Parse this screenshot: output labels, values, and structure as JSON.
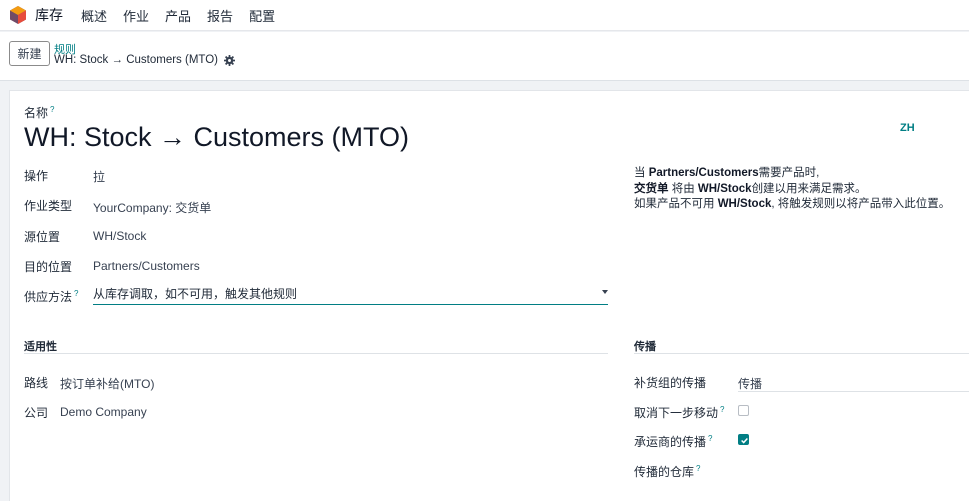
{
  "topnav": {
    "app_name": "库存",
    "menu": [
      "概述",
      "作业",
      "产品",
      "报告",
      "配置"
    ]
  },
  "controlbar": {
    "new_label": "新建",
    "breadcrumb": "规则",
    "record_title": "WH: Stock → Customers (MTO)"
  },
  "form": {
    "name_label": "名称",
    "name_help": "?",
    "name_value": "WH: Stock → Customers (MTO)",
    "lang": "ZH",
    "fields": [
      {
        "label": "操作",
        "value": "拉"
      },
      {
        "label": "作业类型",
        "value": "YourCompany: 交货单"
      },
      {
        "label": "源位置",
        "value": "WH/Stock"
      },
      {
        "label": "目的位置",
        "value": "Partners/Customers"
      }
    ],
    "supply": {
      "label": "供应方法",
      "help": "?",
      "value": "从库存调取，如不可用，触发其他规则"
    },
    "info": {
      "l1_a": "当 ",
      "l1_b": "Partners/Customers",
      "l1_c": "需要产品时,",
      "l2_a": "交货单",
      "l2_b": " 将由 ",
      "l2_c": "WH/Stock",
      "l2_d": "创建以用来满足需求。",
      "l3_a": "如果产品不可用 ",
      "l3_b": "WH/Stock",
      "l3_c": ", 将触发规则以将产品带入此位置。"
    },
    "applicability": {
      "title": "适用性",
      "route_label": "路线",
      "route_value": "按订单补给(MTO)",
      "company_label": "公司",
      "company_value": "Demo Company"
    },
    "propagation": {
      "title": "传播",
      "group_label": "补货组的传播",
      "group_value": "传播",
      "cancel_label": "取消下一步移动",
      "cancel_help": "?",
      "cancel_checked": false,
      "carrier_label": "承运商的传播",
      "carrier_help": "?",
      "carrier_checked": true,
      "warehouse_label": "传播的仓库",
      "warehouse_help": "?"
    }
  },
  "colors": {
    "accent": "#017e84",
    "logo_orange": "#f39c12",
    "logo_red": "#e74c3c",
    "logo_purple": "#714b67"
  }
}
